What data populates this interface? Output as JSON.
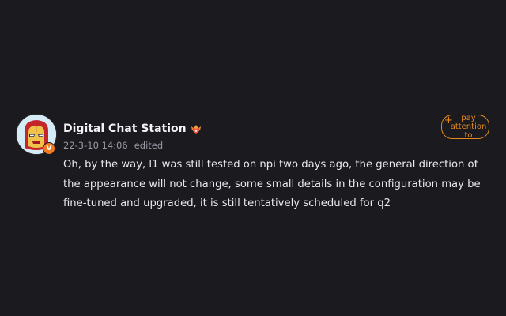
{
  "post": {
    "author": {
      "name": "Digital Chat Station",
      "avatar_icon": "iron-man-icon",
      "verified_badge": "V",
      "level_icon": "crown-heart-icon"
    },
    "meta": {
      "timestamp": "22-3-10 14:06",
      "status": "edited"
    },
    "content": "Oh, by the way, l1 was still tested on npi two days ago, the general direction of the appearance will not change, some small details in the configuration may be fine-tuned and upgraded, it is still tentatively scheduled for q2",
    "follow_button": {
      "plus": "+",
      "label": "pay attention to"
    }
  },
  "colors": {
    "background": "#1b1a1f",
    "accent": "#e58a1b",
    "text_primary": "#f2f2f4",
    "text_secondary": "#9a98a2"
  }
}
